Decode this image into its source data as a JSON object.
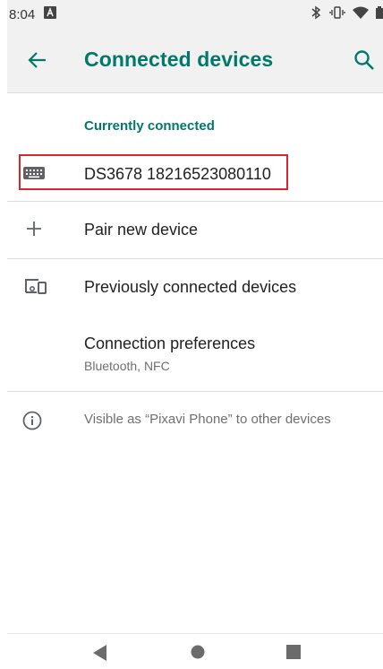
{
  "status_bar": {
    "time": "8:04",
    "icons": [
      "notification-a-icon",
      "bluetooth-icon",
      "vibrate-icon",
      "wifi-icon",
      "battery-icon"
    ]
  },
  "app_bar": {
    "title": "Connected devices",
    "icons": [
      "back-arrow-icon",
      "search-icon"
    ]
  },
  "currently_connected": {
    "header": "Currently connected",
    "device": {
      "icon": "keyboard-icon",
      "name": "DS3678 18216523080110"
    }
  },
  "pair_new_device": {
    "icon": "plus-icon",
    "label": "Pair new device"
  },
  "previously_connected": {
    "icon": "devices-icon",
    "label": "Previously connected devices"
  },
  "connection_preferences": {
    "label": "Connection preferences",
    "summary": "Bluetooth, NFC"
  },
  "visibility": {
    "icon": "info-icon",
    "text": "Visible as “Pixavi Phone” to other devices"
  },
  "nav_bar": {
    "icons": [
      "nav-back-icon",
      "nav-home-icon",
      "nav-recents-icon"
    ]
  },
  "colors": {
    "accent": "#00796b",
    "highlight_border": "#d9262c",
    "bar_bg": "#f1f1f1"
  }
}
